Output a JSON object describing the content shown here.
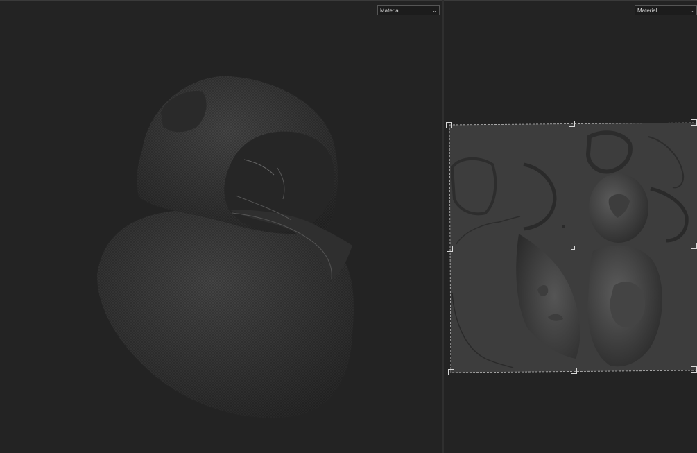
{
  "viewport_3d": {
    "shading_dropdown": {
      "value": "Material"
    }
  },
  "viewport_uv": {
    "shading_dropdown": {
      "value": "Material"
    }
  },
  "icons": {
    "dropdown": "chevron-down-icon",
    "transform_handle": "square-handle-icon"
  },
  "colors": {
    "background": "#232323",
    "panel_divider": "#2f2f2f",
    "uv_canvas": "#3d3d3d",
    "fabric": "#3b3b3b"
  }
}
